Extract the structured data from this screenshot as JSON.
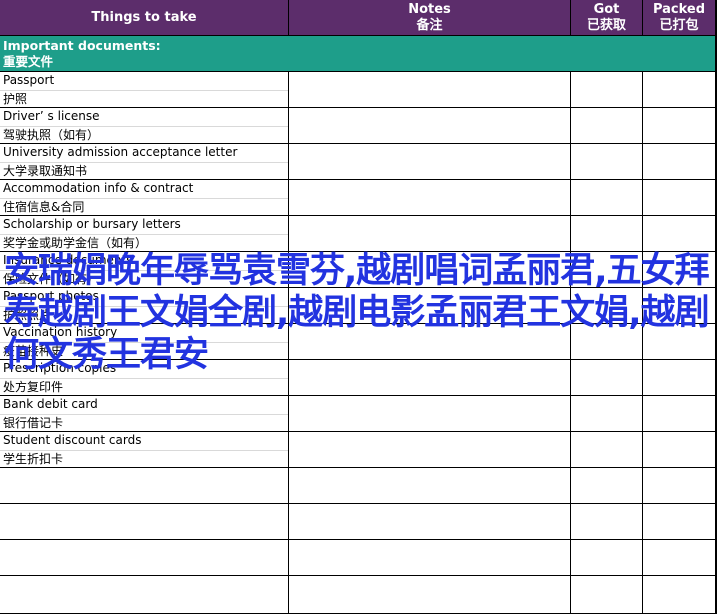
{
  "header": {
    "things": "Things to take",
    "notes_en": "Notes",
    "notes_zh": "备注",
    "got_en": "Got",
    "got_zh": "已获取",
    "packed_en": "Packed",
    "packed_zh": "已打包"
  },
  "section": {
    "title_en": "Important documents:",
    "title_zh": "重要文件"
  },
  "items": [
    {
      "en": "Passport",
      "zh": "护照"
    },
    {
      "en": "Driver’ s license",
      "zh": "驾驶执照（如有）"
    },
    {
      "en": "University admission acceptance letter",
      "zh": "大学录取通知书"
    },
    {
      "en": "Accommodation info & contract",
      "zh": "住宿信息&合同"
    },
    {
      "en": "Scholarship or bursary letters",
      "zh": "奖学金或助学金信（如有）"
    },
    {
      "en": "Insurance documents",
      "zh": "保险文件（如有）"
    },
    {
      "en": "Passport photos",
      "zh": "护照照片"
    },
    {
      "en": "Vaccination history",
      "zh": "疫苗接种史"
    },
    {
      "en": "Prescription copies",
      "zh": "处方复印件"
    },
    {
      "en": "Bank debit card",
      "zh": "银行借记卡"
    },
    {
      "en": "Student discount cards",
      "zh": "学生折扣卡"
    }
  ],
  "overlay_text": "安瑞娟晚年辱骂袁雪芬,越剧唱词孟丽君,五女拜寿越剧王文娟全剧,越剧电影孟丽君王文娟,越剧何文秀王君安"
}
